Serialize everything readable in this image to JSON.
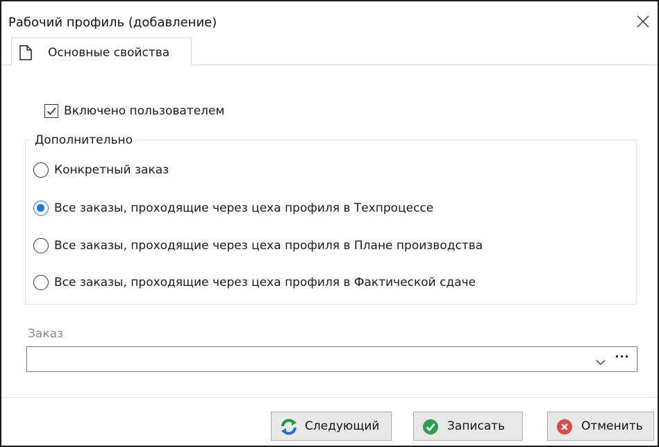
{
  "window": {
    "title": "Рабочий профиль (добавление)",
    "close_icon": "close-icon"
  },
  "tabs": [
    {
      "label": "Основные свойства",
      "icon": "document-icon",
      "active": true
    }
  ],
  "form": {
    "enabled_checkbox": {
      "label": "Включено пользователем",
      "checked": true
    },
    "group": {
      "title": "Дополнительно",
      "options": [
        {
          "label": "Конкретный заказ",
          "selected": false
        },
        {
          "label": "Все заказы, проходящие через цеха профиля в Техпроцессе",
          "selected": true
        },
        {
          "label": "Все заказы, проходящие через цеха профиля в Плане  производства",
          "selected": false
        },
        {
          "label": "Все заказы, проходящие через цеха профиля в Фактической сдаче",
          "selected": false
        }
      ]
    },
    "order_field": {
      "label": "Заказ",
      "value": "",
      "ellipsis": "···"
    }
  },
  "footer": {
    "next_label": "Следующий",
    "save_label": "Записать",
    "cancel_label": "Отменить"
  },
  "colors": {
    "accent": "#1a73e8",
    "save_green": "#2e9e4f",
    "cancel_red": "#e04848",
    "refresh_green": "#1f9a3a",
    "refresh_blue": "#1e6fd9"
  }
}
